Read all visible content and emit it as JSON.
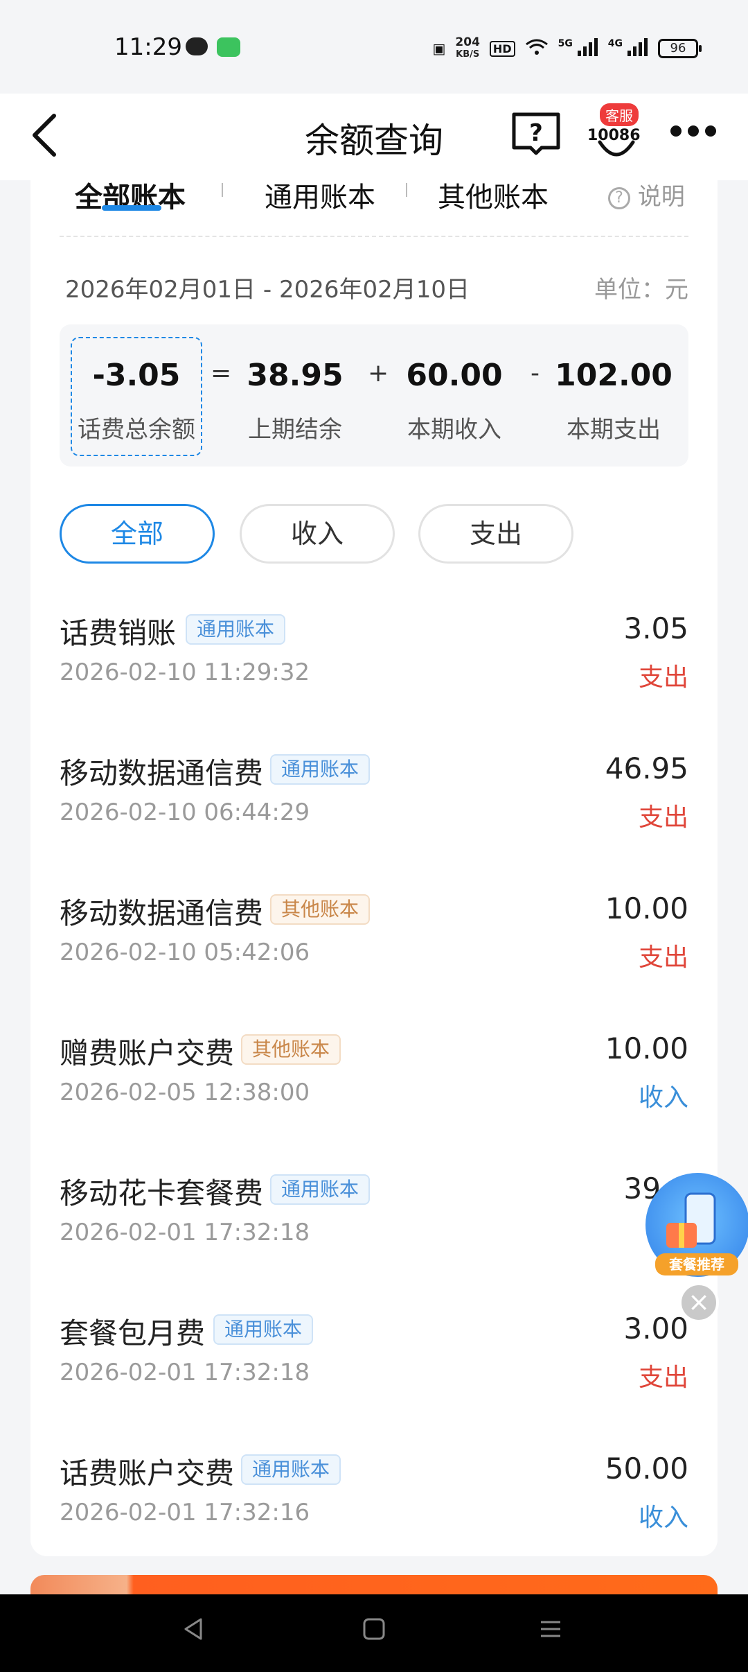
{
  "status_bar": {
    "time": "11:29",
    "net_speed_value": "204",
    "net_speed_unit": "KB/S",
    "hd_label": "HD",
    "sig1_label": "5G",
    "sig2_label": "4G",
    "battery": "96"
  },
  "header": {
    "title": "余额查询",
    "service_badge": "客服",
    "service_number": "10086"
  },
  "tabs": {
    "all": "全部账本",
    "general": "通用账本",
    "other": "其他账本",
    "help": "说明"
  },
  "summary": {
    "date_range": "2026年02月01日 - 2026年02月10日",
    "unit": "单位：元",
    "total_value": "-3.05",
    "total_label": "话费总余额",
    "prev_value": "38.95",
    "prev_label": "上期结余",
    "income_value": "60.00",
    "income_label": "本期收入",
    "expense_value": "102.00",
    "expense_label": "本期支出",
    "op_eq": "=",
    "op_plus": "+",
    "op_minus": "-"
  },
  "filters": {
    "all": "全部",
    "income": "收入",
    "expense": "支出"
  },
  "transactions": [
    {
      "title": "话费销账",
      "tag": "通用账本",
      "time": "2026-02-10 11:29:32",
      "amount": "3.05",
      "type": "支出"
    },
    {
      "title": "移动数据通信费",
      "tag": "通用账本",
      "time": "2026-02-10 06:44:29",
      "amount": "46.95",
      "type": "支出"
    },
    {
      "title": "移动数据通信费",
      "tag": "其他账本",
      "time": "2026-02-10 05:42:06",
      "amount": "10.00",
      "type": "支出"
    },
    {
      "title": "赠费账户交费",
      "tag": "其他账本",
      "time": "2026-02-05 12:38:00",
      "amount": "10.00",
      "type": "收入"
    },
    {
      "title": "移动花卡套餐费",
      "tag": "通用账本",
      "time": "2026-02-01 17:32:18",
      "amount": "39.0",
      "type": "支"
    },
    {
      "title": "套餐包月费",
      "tag": "通用账本",
      "time": "2026-02-01 17:32:18",
      "amount": "3.00",
      "type": "支出"
    },
    {
      "title": "话费账户交费",
      "tag": "通用账本",
      "time": "2026-02-01 17:32:16",
      "amount": "50.00",
      "type": "收入"
    }
  ],
  "promo": {
    "label": "套餐推荐"
  },
  "colors": {
    "accent": "#1e88e5",
    "expense": "#e0463a",
    "income": "#3a8fd9"
  }
}
